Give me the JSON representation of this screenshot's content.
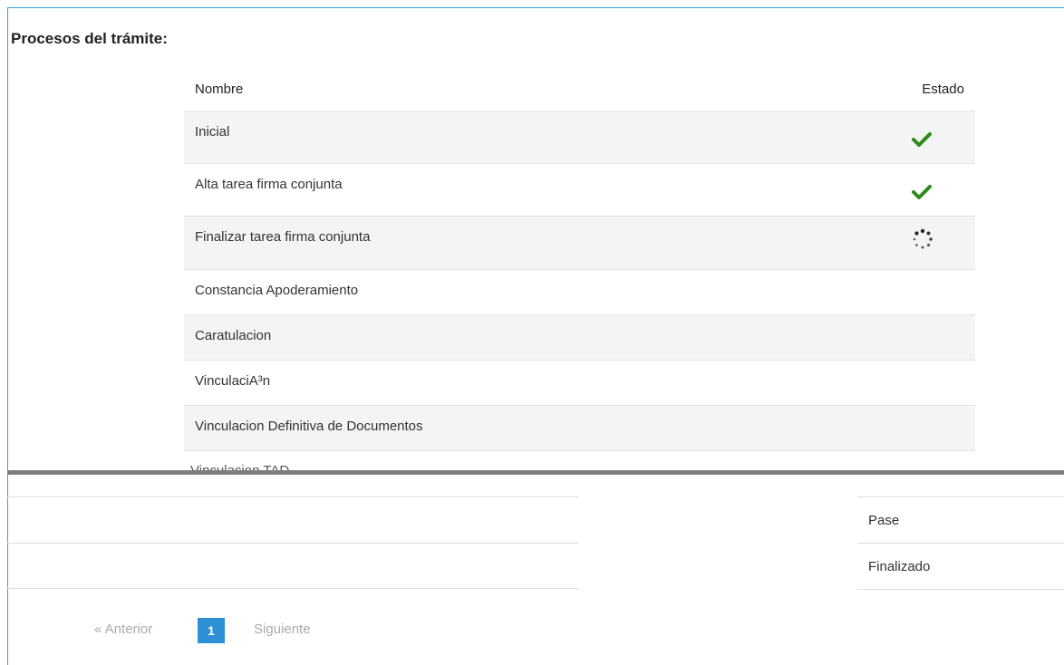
{
  "section_title": "Procesos del trámite:",
  "table": {
    "headers": {
      "name": "Nombre",
      "state": "Estado"
    },
    "rows": [
      {
        "name": "Inicial",
        "state_icon": "check-icon"
      },
      {
        "name": "Alta tarea firma conjunta",
        "state_icon": "check-icon"
      },
      {
        "name": "Finalizar tarea firma conjunta",
        "state_icon": "loading-spinner-icon"
      },
      {
        "name": "Constancia Apoderamiento",
        "state_icon": ""
      },
      {
        "name": "Caratulacion",
        "state_icon": ""
      },
      {
        "name": "VinculaciA³n",
        "state_icon": ""
      },
      {
        "name": "Vinculacion Definitiva de Documentos",
        "state_icon": ""
      }
    ]
  },
  "overlap_text": "Vinculacion TAD",
  "bottom_right_rows": [
    "Pase",
    "Finalizado"
  ],
  "pagination": {
    "prev": "« Anterior",
    "current": "1",
    "next": "Siguiente"
  },
  "colors": {
    "accent": "#2d8fd4",
    "check": "#2e8b1e",
    "border": "#39a6dc"
  }
}
